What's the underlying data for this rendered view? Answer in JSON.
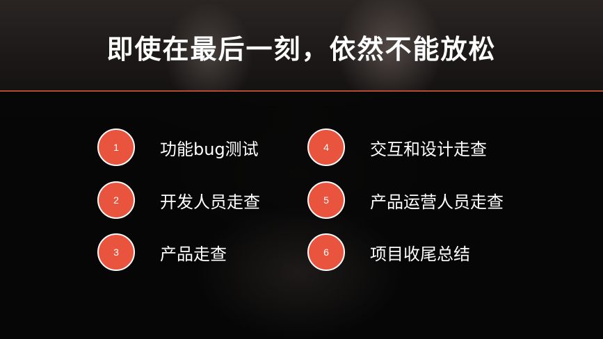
{
  "slide": {
    "title": "即使在最后一刻，依然不能放松",
    "colors": {
      "accent": "#e9543f",
      "divider": "#b5493a",
      "text": "#ffffff",
      "background": "#0b0b0b"
    },
    "items": [
      {
        "number": "1",
        "label": "功能bug测试"
      },
      {
        "number": "2",
        "label": "开发人员走查"
      },
      {
        "number": "3",
        "label": "产品走查"
      },
      {
        "number": "4",
        "label": "交互和设计走查"
      },
      {
        "number": "5",
        "label": "产品运营人员走查"
      },
      {
        "number": "6",
        "label": "项目收尾总结"
      }
    ]
  }
}
